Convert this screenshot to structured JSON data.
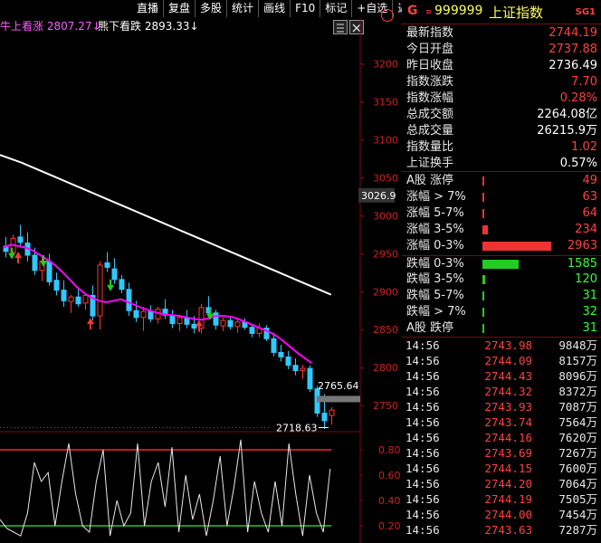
{
  "toolbar": {
    "buttons": [
      "直播",
      "复盘",
      "多股",
      "统计",
      "画线",
      "F10",
      "标记",
      "+自选",
      "返回"
    ]
  },
  "legend": {
    "bull": {
      "label": "牛上看涨",
      "value": "2807.27"
    },
    "bear": {
      "label": "熊下看跌",
      "value": "2893.33"
    }
  },
  "icons": {
    "grid": "grid-icon",
    "clear": "clear-icon",
    "circle": "circle-icon",
    "bull_arrow": "down-arrow-icon",
    "bear_arrow": "down-arrow-icon"
  },
  "colors": {
    "accent_red": "#ff2a2a",
    "up": "#ff3333",
    "down": "#30c8ff",
    "ma_white": "#ffffff",
    "ma_magenta": "#ff00ff",
    "bull_line": "#e0c070",
    "bull_text": "#ff5aff",
    "vol_bar_green": "#22cc22",
    "vol_bar_red": "#ee3333"
  },
  "header": {
    "badge": "G",
    "code": "999999",
    "name": "上证指数",
    "tag": "SG1"
  },
  "stats": [
    {
      "label": "最新指数",
      "value": "2744.19",
      "color": "#ff4040"
    },
    {
      "label": "今日开盘",
      "value": "2737.88",
      "color": "#ff4040"
    },
    {
      "label": "昨日收盘",
      "value": "2736.49",
      "color": "#ffffff"
    },
    {
      "label": "指数涨跌",
      "value": "7.70",
      "color": "#ff4040"
    },
    {
      "label": "指数涨幅",
      "value": "0.28%",
      "color": "#ff4040"
    },
    {
      "label": "总成交额",
      "value": "2264.08亿",
      "color": "#ffffff"
    },
    {
      "label": "总成交量",
      "value": "26215.9万",
      "color": "#ffffff"
    },
    {
      "label": "指数量比",
      "value": "1.02",
      "color": "#ff4040"
    },
    {
      "label": "上证换手",
      "value": "0.57%",
      "color": "#ffffff"
    }
  ],
  "breadth": [
    {
      "label": "A股 涨停",
      "count": "49",
      "color": "#ff4040",
      "bar": 0.004
    },
    {
      "label": "涨幅 > 7%",
      "count": "63",
      "color": "#ff4040",
      "bar": 0.006
    },
    {
      "label": "涨幅 5-7%",
      "count": "64",
      "color": "#ff4040",
      "bar": 0.006
    },
    {
      "label": "涨幅 3-5%",
      "count": "234",
      "color": "#ff4040",
      "bar": 0.08
    },
    {
      "label": "涨幅 0-3%",
      "count": "2963",
      "color": "#ff4040",
      "bar": 1.0
    },
    {
      "label": "跌幅 0-3%",
      "count": "1585",
      "color": "#33ff33",
      "bar": 0.53
    },
    {
      "label": "跌幅 3-5%",
      "count": "120",
      "color": "#33ff33",
      "bar": 0.04
    },
    {
      "label": "跌幅 5-7%",
      "count": "31",
      "color": "#33ff33",
      "bar": 0.006
    },
    {
      "label": "跌幅 > 7%",
      "count": "32",
      "color": "#33ff33",
      "bar": 0.006
    },
    {
      "label": "A股 跌停",
      "count": "31",
      "color": "#33ff33",
      "bar": 0.006
    }
  ],
  "ticks": [
    {
      "time": "14:56",
      "price": "2743.98",
      "vol": "9848万"
    },
    {
      "time": "14:56",
      "price": "2744.09",
      "vol": "8157万"
    },
    {
      "time": "14:56",
      "price": "2744.43",
      "vol": "8096万"
    },
    {
      "time": "14:56",
      "price": "2744.32",
      "vol": "8372万"
    },
    {
      "time": "14:56",
      "price": "2743.93",
      "vol": "7087万"
    },
    {
      "time": "14:56",
      "price": "2743.74",
      "vol": "7564万"
    },
    {
      "time": "14:56",
      "price": "2744.16",
      "vol": "7620万"
    },
    {
      "time": "14:56",
      "price": "2743.69",
      "vol": "7267万"
    },
    {
      "time": "14:56",
      "price": "2744.15",
      "vol": "7600万"
    },
    {
      "time": "14:56",
      "price": "2744.20",
      "vol": "7064万"
    },
    {
      "time": "14:56",
      "price": "2744.19",
      "vol": "7505万"
    },
    {
      "time": "14:56",
      "price": "2744.00",
      "vol": "7454万"
    },
    {
      "time": "14:56",
      "price": "2743.63",
      "vol": "7287万"
    }
  ],
  "chart_data": {
    "type": "candlestick",
    "yaxis_labels": [
      "3200",
      "3150",
      "3100",
      "3050",
      "3000",
      "2950",
      "2900",
      "2850",
      "2800",
      "2750"
    ],
    "ylim": [
      2718,
      3234
    ],
    "current_price_label": "3026.9",
    "annotations": {
      "recent_high": "2765.64",
      "recent_low": "2718.63"
    },
    "candles": [
      {
        "o": 2960,
        "h": 2972,
        "l": 2945,
        "c": 2953
      },
      {
        "o": 2952,
        "h": 2975,
        "l": 2948,
        "c": 2970
      },
      {
        "o": 2972,
        "h": 2988,
        "l": 2960,
        "c": 2965
      },
      {
        "o": 2964,
        "h": 2978,
        "l": 2940,
        "c": 2948
      },
      {
        "o": 2948,
        "h": 2958,
        "l": 2922,
        "c": 2928
      },
      {
        "o": 2928,
        "h": 2946,
        "l": 2914,
        "c": 2940
      },
      {
        "o": 2940,
        "h": 2950,
        "l": 2908,
        "c": 2913
      },
      {
        "o": 2915,
        "h": 2925,
        "l": 2895,
        "c": 2902
      },
      {
        "o": 2902,
        "h": 2915,
        "l": 2880,
        "c": 2888
      },
      {
        "o": 2887,
        "h": 2896,
        "l": 2872,
        "c": 2893
      },
      {
        "o": 2893,
        "h": 2903,
        "l": 2880,
        "c": 2884
      },
      {
        "o": 2885,
        "h": 2898,
        "l": 2876,
        "c": 2895
      },
      {
        "o": 2895,
        "h": 2908,
        "l": 2862,
        "c": 2868
      },
      {
        "o": 2868,
        "h": 2940,
        "l": 2850,
        "c": 2935
      },
      {
        "o": 2938,
        "h": 2952,
        "l": 2926,
        "c": 2932
      },
      {
        "o": 2930,
        "h": 2944,
        "l": 2910,
        "c": 2916
      },
      {
        "o": 2916,
        "h": 2922,
        "l": 2898,
        "c": 2903
      },
      {
        "o": 2903,
        "h": 2912,
        "l": 2868,
        "c": 2875
      },
      {
        "o": 2875,
        "h": 2888,
        "l": 2860,
        "c": 2866
      },
      {
        "o": 2866,
        "h": 2880,
        "l": 2848,
        "c": 2874
      },
      {
        "o": 2874,
        "h": 2882,
        "l": 2860,
        "c": 2864
      },
      {
        "o": 2864,
        "h": 2880,
        "l": 2858,
        "c": 2877
      },
      {
        "o": 2877,
        "h": 2890,
        "l": 2864,
        "c": 2869
      },
      {
        "o": 2868,
        "h": 2876,
        "l": 2852,
        "c": 2858
      },
      {
        "o": 2858,
        "h": 2870,
        "l": 2848,
        "c": 2866
      },
      {
        "o": 2866,
        "h": 2876,
        "l": 2852,
        "c": 2857
      },
      {
        "o": 2857,
        "h": 2868,
        "l": 2845,
        "c": 2852
      },
      {
        "o": 2852,
        "h": 2884,
        "l": 2845,
        "c": 2879
      },
      {
        "o": 2879,
        "h": 2894,
        "l": 2868,
        "c": 2872
      },
      {
        "o": 2872,
        "h": 2876,
        "l": 2850,
        "c": 2856
      },
      {
        "o": 2855,
        "h": 2866,
        "l": 2848,
        "c": 2862
      },
      {
        "o": 2862,
        "h": 2868,
        "l": 2850,
        "c": 2854
      },
      {
        "o": 2854,
        "h": 2864,
        "l": 2846,
        "c": 2860
      },
      {
        "o": 2860,
        "h": 2865,
        "l": 2850,
        "c": 2853
      },
      {
        "o": 2853,
        "h": 2858,
        "l": 2840,
        "c": 2845
      },
      {
        "o": 2845,
        "h": 2858,
        "l": 2840,
        "c": 2852
      },
      {
        "o": 2852,
        "h": 2856,
        "l": 2835,
        "c": 2838
      },
      {
        "o": 2838,
        "h": 2846,
        "l": 2815,
        "c": 2820
      },
      {
        "o": 2820,
        "h": 2830,
        "l": 2808,
        "c": 2814
      },
      {
        "o": 2814,
        "h": 2822,
        "l": 2798,
        "c": 2803
      },
      {
        "o": 2803,
        "h": 2812,
        "l": 2790,
        "c": 2796
      },
      {
        "o": 2796,
        "h": 2804,
        "l": 2785,
        "c": 2799
      },
      {
        "o": 2799,
        "h": 2803,
        "l": 2768,
        "c": 2772
      },
      {
        "o": 2772,
        "h": 2776,
        "l": 2735,
        "c": 2740
      },
      {
        "o": 2740,
        "h": 2765,
        "l": 2719,
        "c": 2730
      },
      {
        "o": 2737,
        "h": 2748,
        "l": 2725,
        "c": 2744
      }
    ],
    "ma_long": [
      3080,
      3075,
      3070,
      3064,
      3058,
      3052,
      3046,
      3040,
      3034,
      3028,
      3022,
      3016,
      3010,
      3004,
      2998,
      2992,
      2986,
      2980,
      2974,
      2968,
      2962,
      2956,
      2950,
      2944,
      2938,
      2932,
      2926,
      2920,
      2914,
      2908,
      2902,
      2896
    ],
    "ma_short": [
      2958,
      2962,
      2960,
      2958,
      2954,
      2948,
      2942,
      2935,
      2926,
      2916,
      2906,
      2898,
      2892,
      2888,
      2886,
      2888,
      2890,
      2886,
      2882,
      2878,
      2875,
      2872,
      2870,
      2869,
      2868,
      2866,
      2864,
      2863,
      2865,
      2868,
      2868,
      2867,
      2864,
      2860,
      2856,
      2852,
      2848,
      2843,
      2836,
      2828,
      2820,
      2813,
      2806
    ],
    "indicator": {
      "levels": [
        "0.80",
        "0.60",
        "0.40",
        "0.20"
      ],
      "ylim": [
        0.1,
        0.9
      ],
      "upper_line": 0.8,
      "lower_line": 0.2,
      "values": [
        0.25,
        0.18,
        0.15,
        0.12,
        0.3,
        0.7,
        0.55,
        0.62,
        0.2,
        0.55,
        0.85,
        0.45,
        0.2,
        0.15,
        0.55,
        0.8,
        0.12,
        0.4,
        0.2,
        0.3,
        0.85,
        0.2,
        0.55,
        0.7,
        0.35,
        0.82,
        0.15,
        0.6,
        0.25,
        0.45,
        0.12,
        0.4,
        0.75,
        0.2,
        0.5,
        0.88,
        0.15,
        0.55,
        0.3,
        0.15,
        0.55,
        0.2,
        0.85,
        0.45,
        0.12,
        0.6,
        0.3,
        0.15,
        0.65
      ]
    }
  }
}
